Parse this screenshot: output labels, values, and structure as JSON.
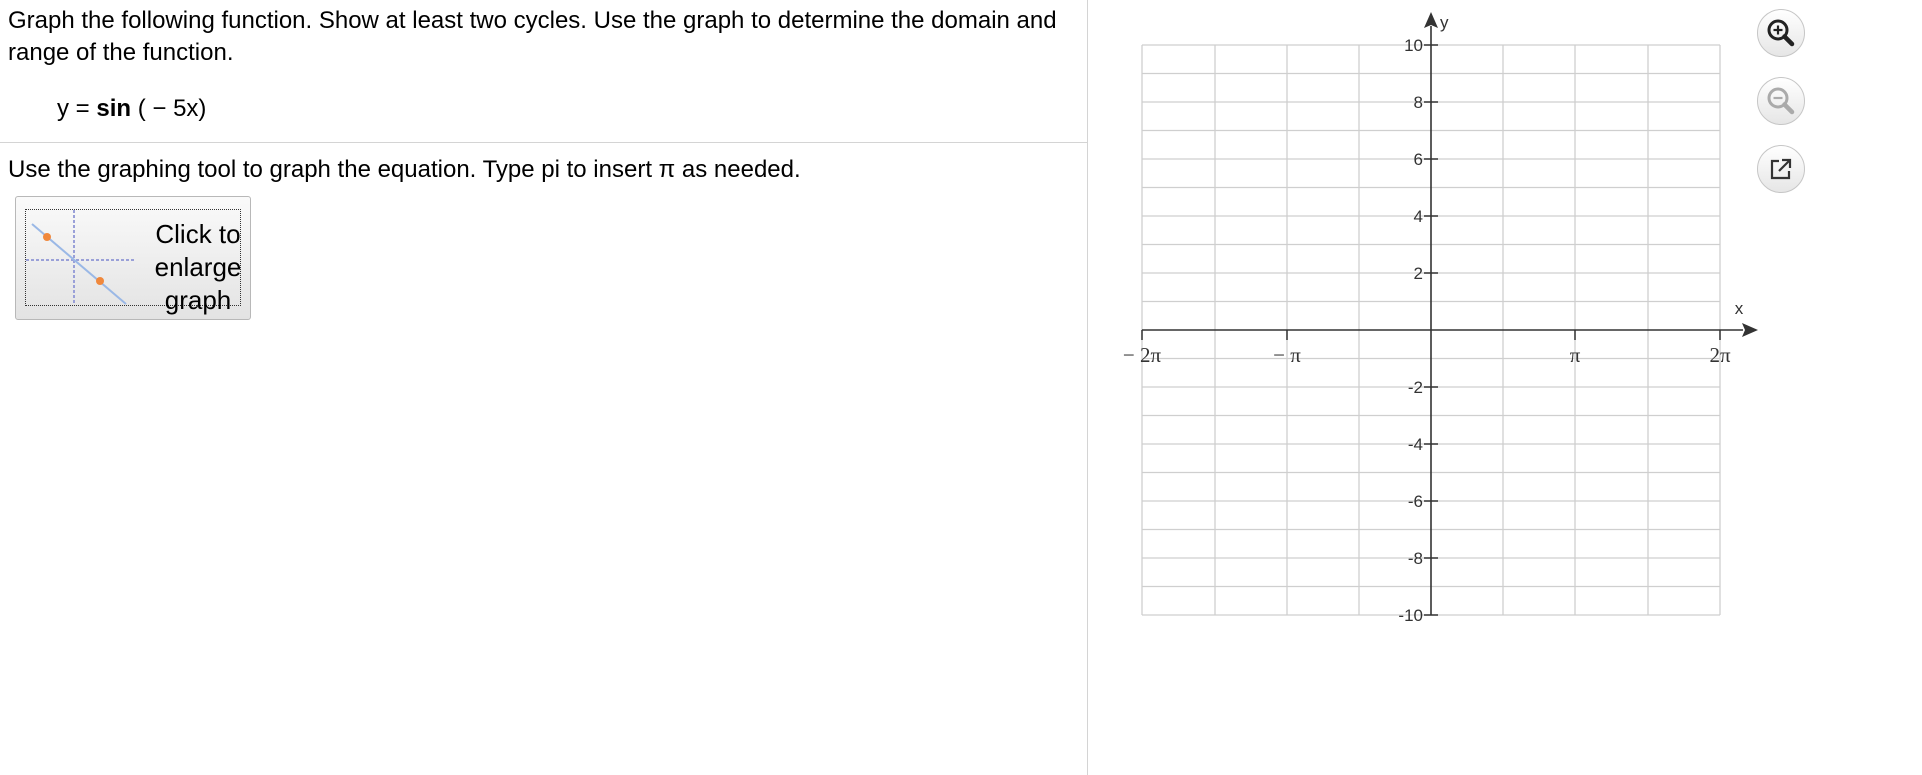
{
  "question": {
    "text": "Graph the following function. Show at least two cycles. Use the graph to determine the domain and range of the function.",
    "equation_prefix": "y =",
    "equation_func": "sin",
    "equation_arg": "( − 5x)"
  },
  "instruction": "Use the graphing tool to graph the equation. Type pi to insert π as needed.",
  "enlarge_button": {
    "line1": "Click to",
    "line2": "enlarge",
    "line3": "graph"
  },
  "graph": {
    "x_axis_label": "x",
    "y_axis_label": "y",
    "x_tick_labels": [
      "− 2π",
      "− π",
      "π",
      "2π"
    ],
    "y_tick_labels": [
      "10",
      "8",
      "6",
      "4",
      "2",
      "-2",
      "-4",
      "-6",
      "-8",
      "-10"
    ],
    "x_range": [
      "−2π",
      "2π"
    ],
    "y_range": [
      -10,
      10
    ],
    "grid": true
  },
  "tools": {
    "zoom_in": "zoom-in-icon",
    "zoom_out": "zoom-out-icon",
    "popout": "popout-icon"
  },
  "colors": {
    "grid": "#cfcfcf",
    "axis": "#333333",
    "thumb_line": "#9ab8e6",
    "thumb_point": "#f0883c"
  }
}
